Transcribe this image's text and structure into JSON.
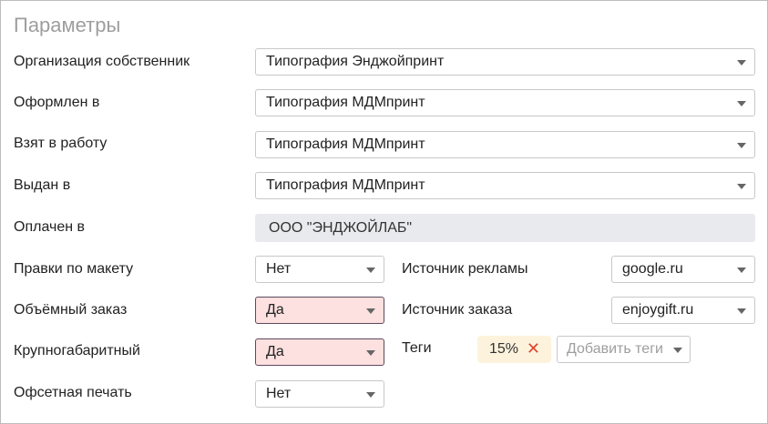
{
  "title": "Параметры",
  "fields": {
    "owner_org": {
      "label": "Организация собственник",
      "value": "Типография Энджойпринт"
    },
    "issued_in": {
      "label": "Оформлен в",
      "value": "Типография МДМпринт"
    },
    "taken_into_work": {
      "label": "Взят в работу",
      "value": "Типография МДМпринт"
    },
    "delivered_in": {
      "label": "Выдан в",
      "value": "Типография МДМпринт"
    },
    "paid_in": {
      "label": "Оплачен в",
      "value": "ООО \"ЭНДЖОЙЛАБ\""
    },
    "layout_edits": {
      "label": "Правки по макету",
      "value": "Нет"
    },
    "bulk_order": {
      "label": "Объёмный заказ",
      "value": "Да"
    },
    "oversized": {
      "label": "Крупногабаритный",
      "value": "Да"
    },
    "offset_print": {
      "label": "Офсетная печать",
      "value": "Нет"
    },
    "ad_source": {
      "label": "Источник рекламы",
      "value": "google.ru"
    },
    "order_source": {
      "label": "Источник заказа",
      "value": "enjoygift.ru"
    },
    "tags": {
      "label": "Теги",
      "items": [
        {
          "text": "15%",
          "remove_icon": "close-icon"
        }
      ],
      "add_placeholder": "Добавить теги"
    }
  },
  "colors": {
    "alert_bg": "#fde0e0",
    "tag_bg": "#fdf3dc",
    "tag_remove": "#e0452f",
    "readonly_bg": "#e8eaed"
  }
}
